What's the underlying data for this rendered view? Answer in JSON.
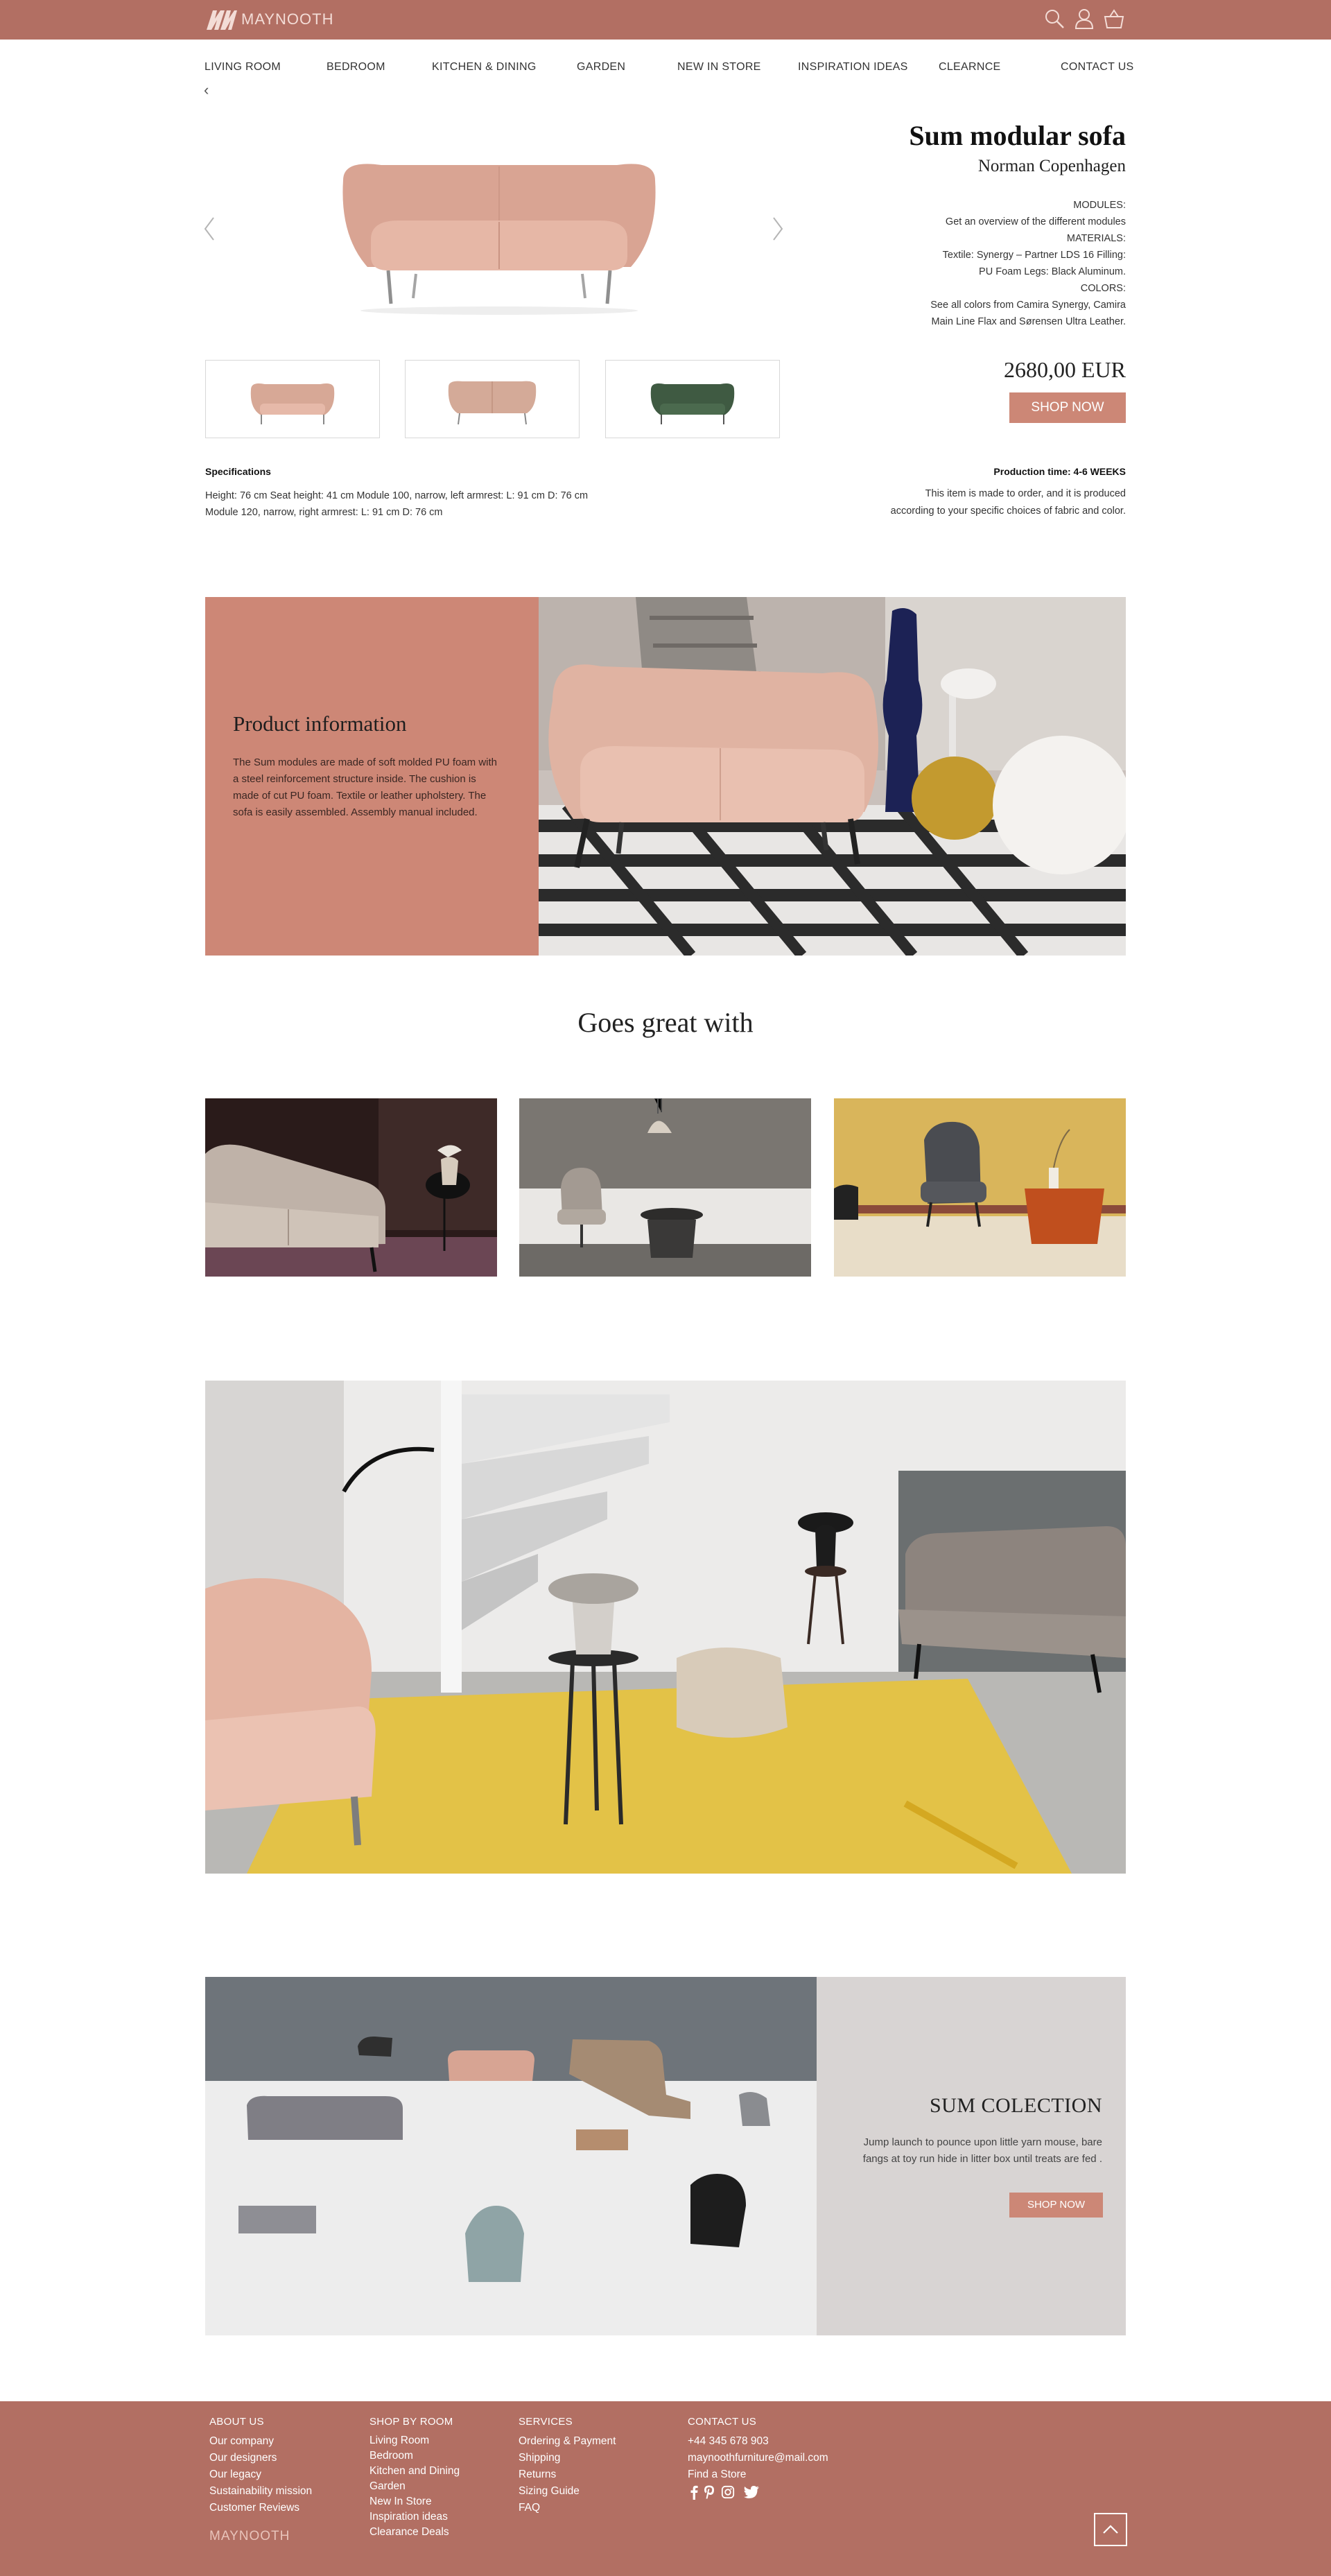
{
  "header": {
    "logo_text": "MAYNOOTH",
    "icons": [
      "search-icon",
      "user-icon",
      "basket-icon"
    ]
  },
  "nav": {
    "items": [
      "LIVING ROOM",
      "BEDROOM",
      "KITCHEN & DINING",
      "GARDEN",
      "NEW IN STORE",
      "INSPIRATION IDEAS",
      "CLEARNCE",
      "CONTACT US"
    ],
    "back": "‹"
  },
  "product": {
    "title": "Sum modular sofa",
    "brand": "Norman Copenhagen",
    "details": [
      "MODULES:",
      "Get an overview of the different modules",
      "MATERIALS:",
      "Textile: Synergy – Partner LDS 16 Filling:",
      "PU Foam Legs: Black Aluminum.",
      "COLORS:",
      "See all colors from Camira Synergy, Camira",
      "Main Line Flax and Sørensen Ultra Leather."
    ],
    "price": "2680,00 EUR",
    "shop_label": "SHOP NOW",
    "specs_heading": "Specifications",
    "specs_lines": [
      "Height: 76 cm Seat height: 41 cm Module 100, narrow, left armrest: L: 91 cm D: 76 cm",
      "Module 120, narrow, right armrest: L: 91 cm D: 76 cm"
    ],
    "production_heading": "Production time: 4-6 WEEKS",
    "production_lines": [
      "This item is made to order, and it is produced",
      "according to your specific choices of fabric and color."
    ],
    "thumb_colors": [
      "#d7a896",
      "#d4aa98",
      "#3f5a42"
    ]
  },
  "info": {
    "heading": "Product information",
    "text": "The Sum modules are made of soft molded PU foam with a steel reinforcement structure inside. The cushion is made of cut PU foam. Textile or leather upholstery. The sofa is easily assembled. Assembly manual included."
  },
  "goes": {
    "heading": "Goes great with"
  },
  "collection": {
    "heading": "SUM COLECTION",
    "text": "Jump launch to pounce upon little yarn mouse, bare fangs at toy run hide in litter box until treats are fed .",
    "shop_label": "SHOP NOW"
  },
  "footer": {
    "about": {
      "heading": "ABOUT US",
      "links": [
        "Our company",
        "Our designers",
        "Our legacy",
        "Sustainability mission",
        "Customer Reviews"
      ]
    },
    "shop": {
      "heading": "SHOP BY ROOM",
      "links": [
        "Living Room",
        "Bedroom",
        "Kitchen and Dining",
        "Garden",
        "New In Store",
        "Inspiration ideas",
        "Clearance Deals"
      ]
    },
    "services": {
      "heading": "SERVICES",
      "links": [
        "Ordering & Payment",
        "Shipping",
        "Returns",
        "Sizing Guide",
        "FAQ"
      ]
    },
    "contact": {
      "heading": "CONTACT US",
      "links": [
        "+44 345 678 903",
        "maynoothfurniture@mail.com",
        "Find a Store"
      ]
    },
    "brand": "MAYNOOTH",
    "social_icons": [
      "facebook-icon",
      "pinterest-icon",
      "instagram-icon",
      "twitter-icon"
    ]
  },
  "colors": {
    "brand": "#b26f63",
    "accent": "#cc8776",
    "panel": "#cd8776",
    "collection_panel": "#d8d4d3"
  }
}
